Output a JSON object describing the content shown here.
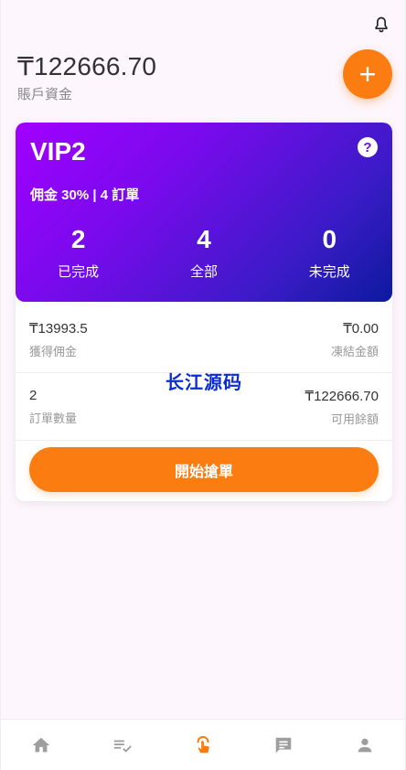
{
  "header": {
    "balance": "₸122666.70",
    "balance_label": "賬戶資金",
    "add_label": "+"
  },
  "vip": {
    "title": "VIP2",
    "help": "?",
    "subtitle": "佣金 30% | 4 訂單",
    "stats": [
      {
        "value": "2",
        "label": "已完成"
      },
      {
        "value": "4",
        "label": "全部"
      },
      {
        "value": "0",
        "label": "未完成"
      }
    ]
  },
  "details": {
    "earned_value": "₸13993.5",
    "earned_label": "獲得佣金",
    "frozen_value": "₸0.00",
    "frozen_label": "凍結金額",
    "orders_value": "2",
    "orders_label": "訂單數量",
    "available_value": "₸122666.70",
    "available_label": "可用餘額"
  },
  "watermark": "长江源码",
  "actions": {
    "start_label": "開始搶單"
  },
  "colors": {
    "accent": "#fb7d12",
    "vip_gradient_start": "#a100ff",
    "vip_gradient_end": "#0c1a9e",
    "tab_active": "#fb7d12",
    "tab_inactive": "#9e9e9e"
  },
  "tabs": [
    {
      "icon": "home-icon",
      "active": false
    },
    {
      "icon": "order-list-icon",
      "active": false
    },
    {
      "icon": "grab-order-icon",
      "active": true
    },
    {
      "icon": "message-icon",
      "active": false
    },
    {
      "icon": "profile-icon",
      "active": false
    }
  ]
}
